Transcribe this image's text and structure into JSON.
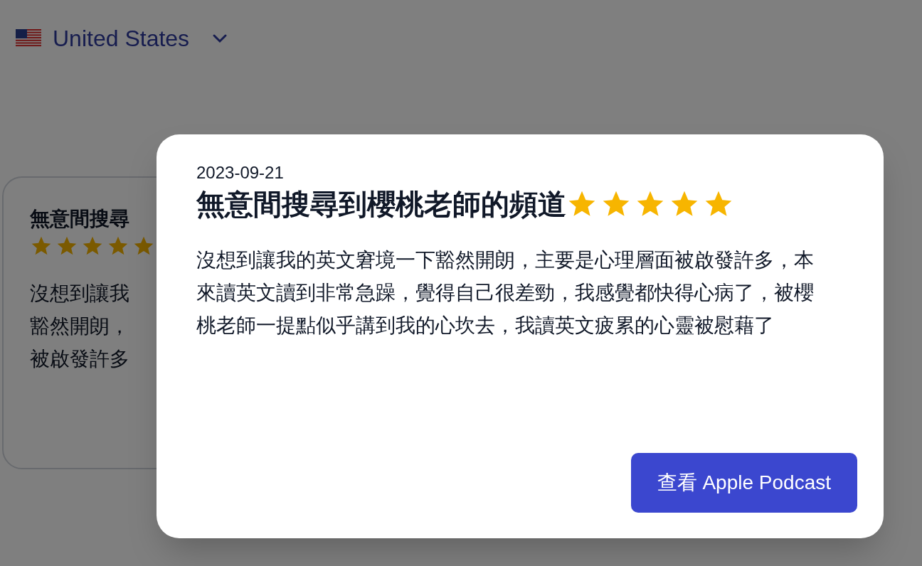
{
  "country_selector": {
    "label": "United States"
  },
  "background_review": {
    "title": "無意間搜尋",
    "stars": 5,
    "body_lines": [
      "沒想到讓我",
      "豁然開朗，",
      "被啟發許多"
    ]
  },
  "review_dialog": {
    "date": "2023-09-21",
    "title": "無意間搜尋到櫻桃老師的頻道",
    "stars": 5,
    "body": "沒想到讓我的英文窘境一下豁然開朗，主要是心理層面被啟發許多，本來讀英文讀到非常急躁，覺得自己很差勁，我感覺都快得心病了，被櫻桃老師一提點似乎講到我的心坎去，我讀英文疲累的心靈被慰藉了",
    "button": "查看 Apple Podcast"
  }
}
